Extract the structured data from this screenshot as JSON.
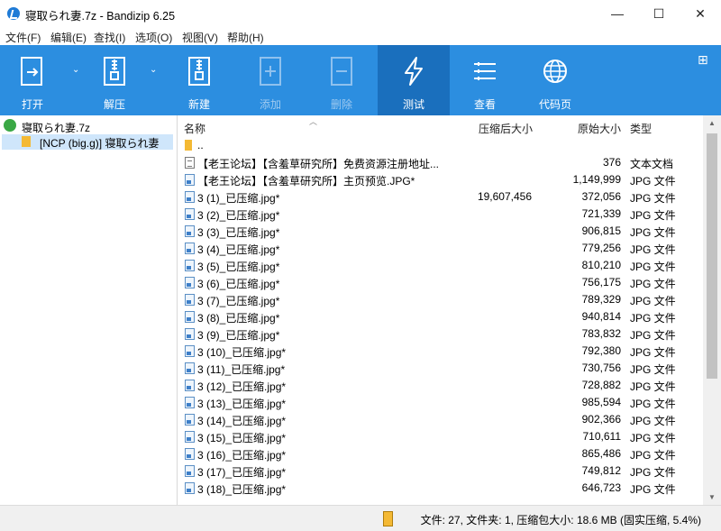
{
  "window": {
    "title": "寝取られ妻.7z - Bandizip 6.25",
    "minimize": "—",
    "maximize": "☐",
    "close": "✕"
  },
  "menu": [
    "文件(F)",
    "编辑(E)",
    "查找(I)",
    "选项(O)",
    "视图(V)",
    "帮助(H)"
  ],
  "toolbar": {
    "open": "打开",
    "extract": "解压",
    "new": "新建",
    "add": "添加",
    "delete": "删除",
    "test": "测试",
    "view": "查看",
    "codepage": "代码页",
    "dropdown_glyph": "⌄",
    "options_glyph": "⊞"
  },
  "tree": {
    "root": "寝取られ妻.7z",
    "child": "[NCP (big.g)] 寝取られ妻"
  },
  "columns": {
    "name": "名称",
    "packed": "压缩后大小",
    "size": "原始大小",
    "type": "类型",
    "sort_glyph": "︿"
  },
  "rows": [
    {
      "icon": "folder-icon",
      "name": "..",
      "packed": "",
      "size": "",
      "type": ""
    },
    {
      "icon": "text-file-icon",
      "name": "【老王论坛】【含羞草研究所】免费资源注册地址...",
      "packed": "",
      "size": "376",
      "type": "文本文档"
    },
    {
      "icon": "image-file-icon",
      "name": "【老王论坛】【含羞草研究所】主页预览.JPG*",
      "packed": "",
      "size": "1,149,999",
      "type": "JPG 文件"
    },
    {
      "icon": "image-file-icon",
      "name": "3 (1)_已压缩.jpg*",
      "packed": "19,607,456",
      "size": "372,056",
      "type": "JPG 文件"
    },
    {
      "icon": "image-file-icon",
      "name": "3 (2)_已压缩.jpg*",
      "packed": "",
      "size": "721,339",
      "type": "JPG 文件"
    },
    {
      "icon": "image-file-icon",
      "name": "3 (3)_已压缩.jpg*",
      "packed": "",
      "size": "906,815",
      "type": "JPG 文件"
    },
    {
      "icon": "image-file-icon",
      "name": "3 (4)_已压缩.jpg*",
      "packed": "",
      "size": "779,256",
      "type": "JPG 文件"
    },
    {
      "icon": "image-file-icon",
      "name": "3 (5)_已压缩.jpg*",
      "packed": "",
      "size": "810,210",
      "type": "JPG 文件"
    },
    {
      "icon": "image-file-icon",
      "name": "3 (6)_已压缩.jpg*",
      "packed": "",
      "size": "756,175",
      "type": "JPG 文件"
    },
    {
      "icon": "image-file-icon",
      "name": "3 (7)_已压缩.jpg*",
      "packed": "",
      "size": "789,329",
      "type": "JPG 文件"
    },
    {
      "icon": "image-file-icon",
      "name": "3 (8)_已压缩.jpg*",
      "packed": "",
      "size": "940,814",
      "type": "JPG 文件"
    },
    {
      "icon": "image-file-icon",
      "name": "3 (9)_已压缩.jpg*",
      "packed": "",
      "size": "783,832",
      "type": "JPG 文件"
    },
    {
      "icon": "image-file-icon",
      "name": "3 (10)_已压缩.jpg*",
      "packed": "",
      "size": "792,380",
      "type": "JPG 文件"
    },
    {
      "icon": "image-file-icon",
      "name": "3 (11)_已压缩.jpg*",
      "packed": "",
      "size": "730,756",
      "type": "JPG 文件"
    },
    {
      "icon": "image-file-icon",
      "name": "3 (12)_已压缩.jpg*",
      "packed": "",
      "size": "728,882",
      "type": "JPG 文件"
    },
    {
      "icon": "image-file-icon",
      "name": "3 (13)_已压缩.jpg*",
      "packed": "",
      "size": "985,594",
      "type": "JPG 文件"
    },
    {
      "icon": "image-file-icon",
      "name": "3 (14)_已压缩.jpg*",
      "packed": "",
      "size": "902,366",
      "type": "JPG 文件"
    },
    {
      "icon": "image-file-icon",
      "name": "3 (15)_已压缩.jpg*",
      "packed": "",
      "size": "710,611",
      "type": "JPG 文件"
    },
    {
      "icon": "image-file-icon",
      "name": "3 (16)_已压缩.jpg*",
      "packed": "",
      "size": "865,486",
      "type": "JPG 文件"
    },
    {
      "icon": "image-file-icon",
      "name": "3 (17)_已压缩.jpg*",
      "packed": "",
      "size": "749,812",
      "type": "JPG 文件"
    },
    {
      "icon": "image-file-icon",
      "name": "3 (18)_已压缩.jpg*",
      "packed": "",
      "size": "646,723",
      "type": "JPG 文件"
    }
  ],
  "status": "文件: 27, 文件夹: 1, 压缩包大小: 18.6 MB (固实压缩, 5.4%)",
  "scrollbar": {
    "up": "▲",
    "down": "▼"
  },
  "colors": {
    "toolbar": "#2c8ee0",
    "toolbar_active": "#1a6fbd",
    "selection": "#cfe6fb"
  }
}
